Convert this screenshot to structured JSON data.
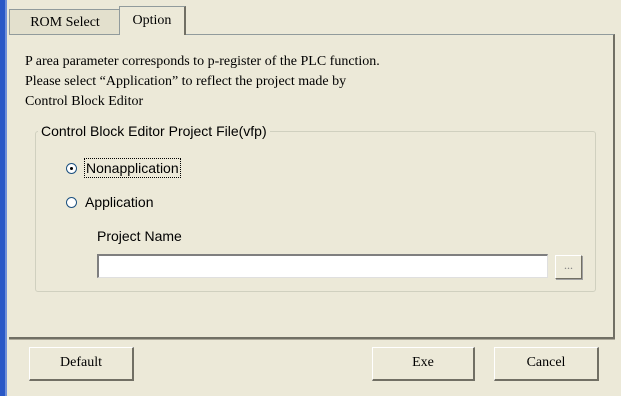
{
  "tabs": [
    {
      "label": "ROM Select",
      "active": false
    },
    {
      "label": "Option",
      "active": true
    }
  ],
  "description": {
    "line1": "P area parameter corresponds to p-register of the PLC function.",
    "line2": "Please select “Application” to reflect the project made by",
    "line3": "Control Block Editor"
  },
  "group": {
    "title": "Control Block Editor Project File(vfp)",
    "options": [
      {
        "label": "Nonapplication",
        "selected": true
      },
      {
        "label": "Application",
        "selected": false
      }
    ],
    "project_name_label": "Project Name",
    "project_name_value": "",
    "browse_label": "..."
  },
  "buttons": {
    "default_label": "Default",
    "exe_label": "Exe",
    "cancel_label": "Cancel"
  }
}
